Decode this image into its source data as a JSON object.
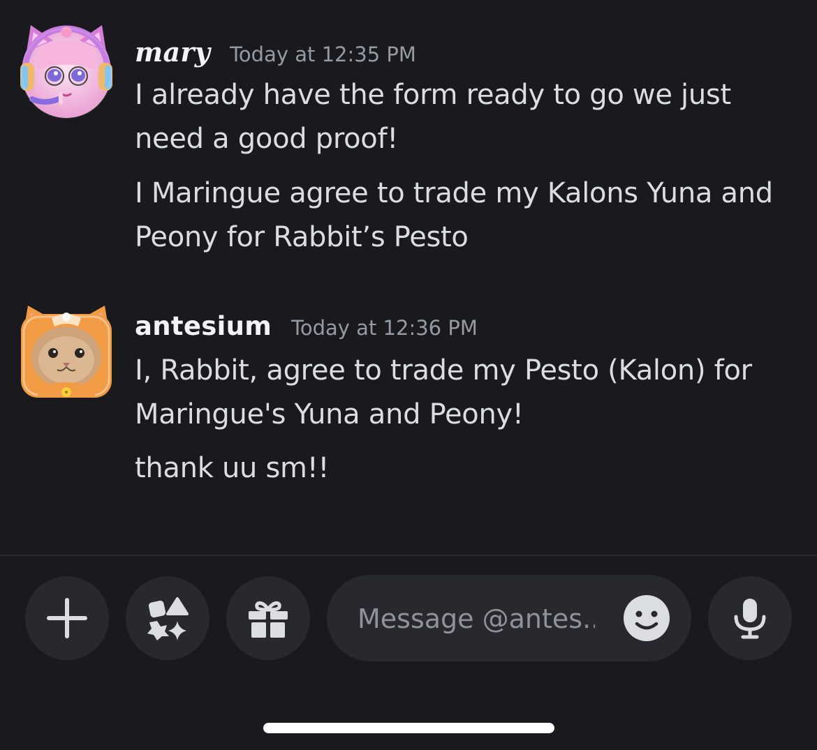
{
  "messages": [
    {
      "username": "mary",
      "timestamp": "Today at 12:35 PM",
      "paragraphs": [
        "I already have the form ready to go we just need a good proof!",
        "I Maringue agree to trade my Kalons Yuna and Peony for Rabbit’s Pesto"
      ]
    },
    {
      "username": "antesium",
      "timestamp": "Today at 12:36 PM",
      "paragraphs": [
        "I, Rabbit, agree to trade my Pesto (Kalon) for Maringue's Yuna and Peony!",
        "thank uu sm!!"
      ]
    }
  ],
  "composer": {
    "placeholder": "Message @antes..",
    "buttons": {
      "add": "plus-icon",
      "apps": "apps-icon",
      "gift": "gift-icon",
      "emoji": "emoji-icon",
      "voice": "microphone-icon"
    }
  },
  "colors": {
    "background": "#1a1a1e",
    "button_bg": "#28292e",
    "text": "#dbdee1",
    "timestamp": "#949ba4"
  }
}
